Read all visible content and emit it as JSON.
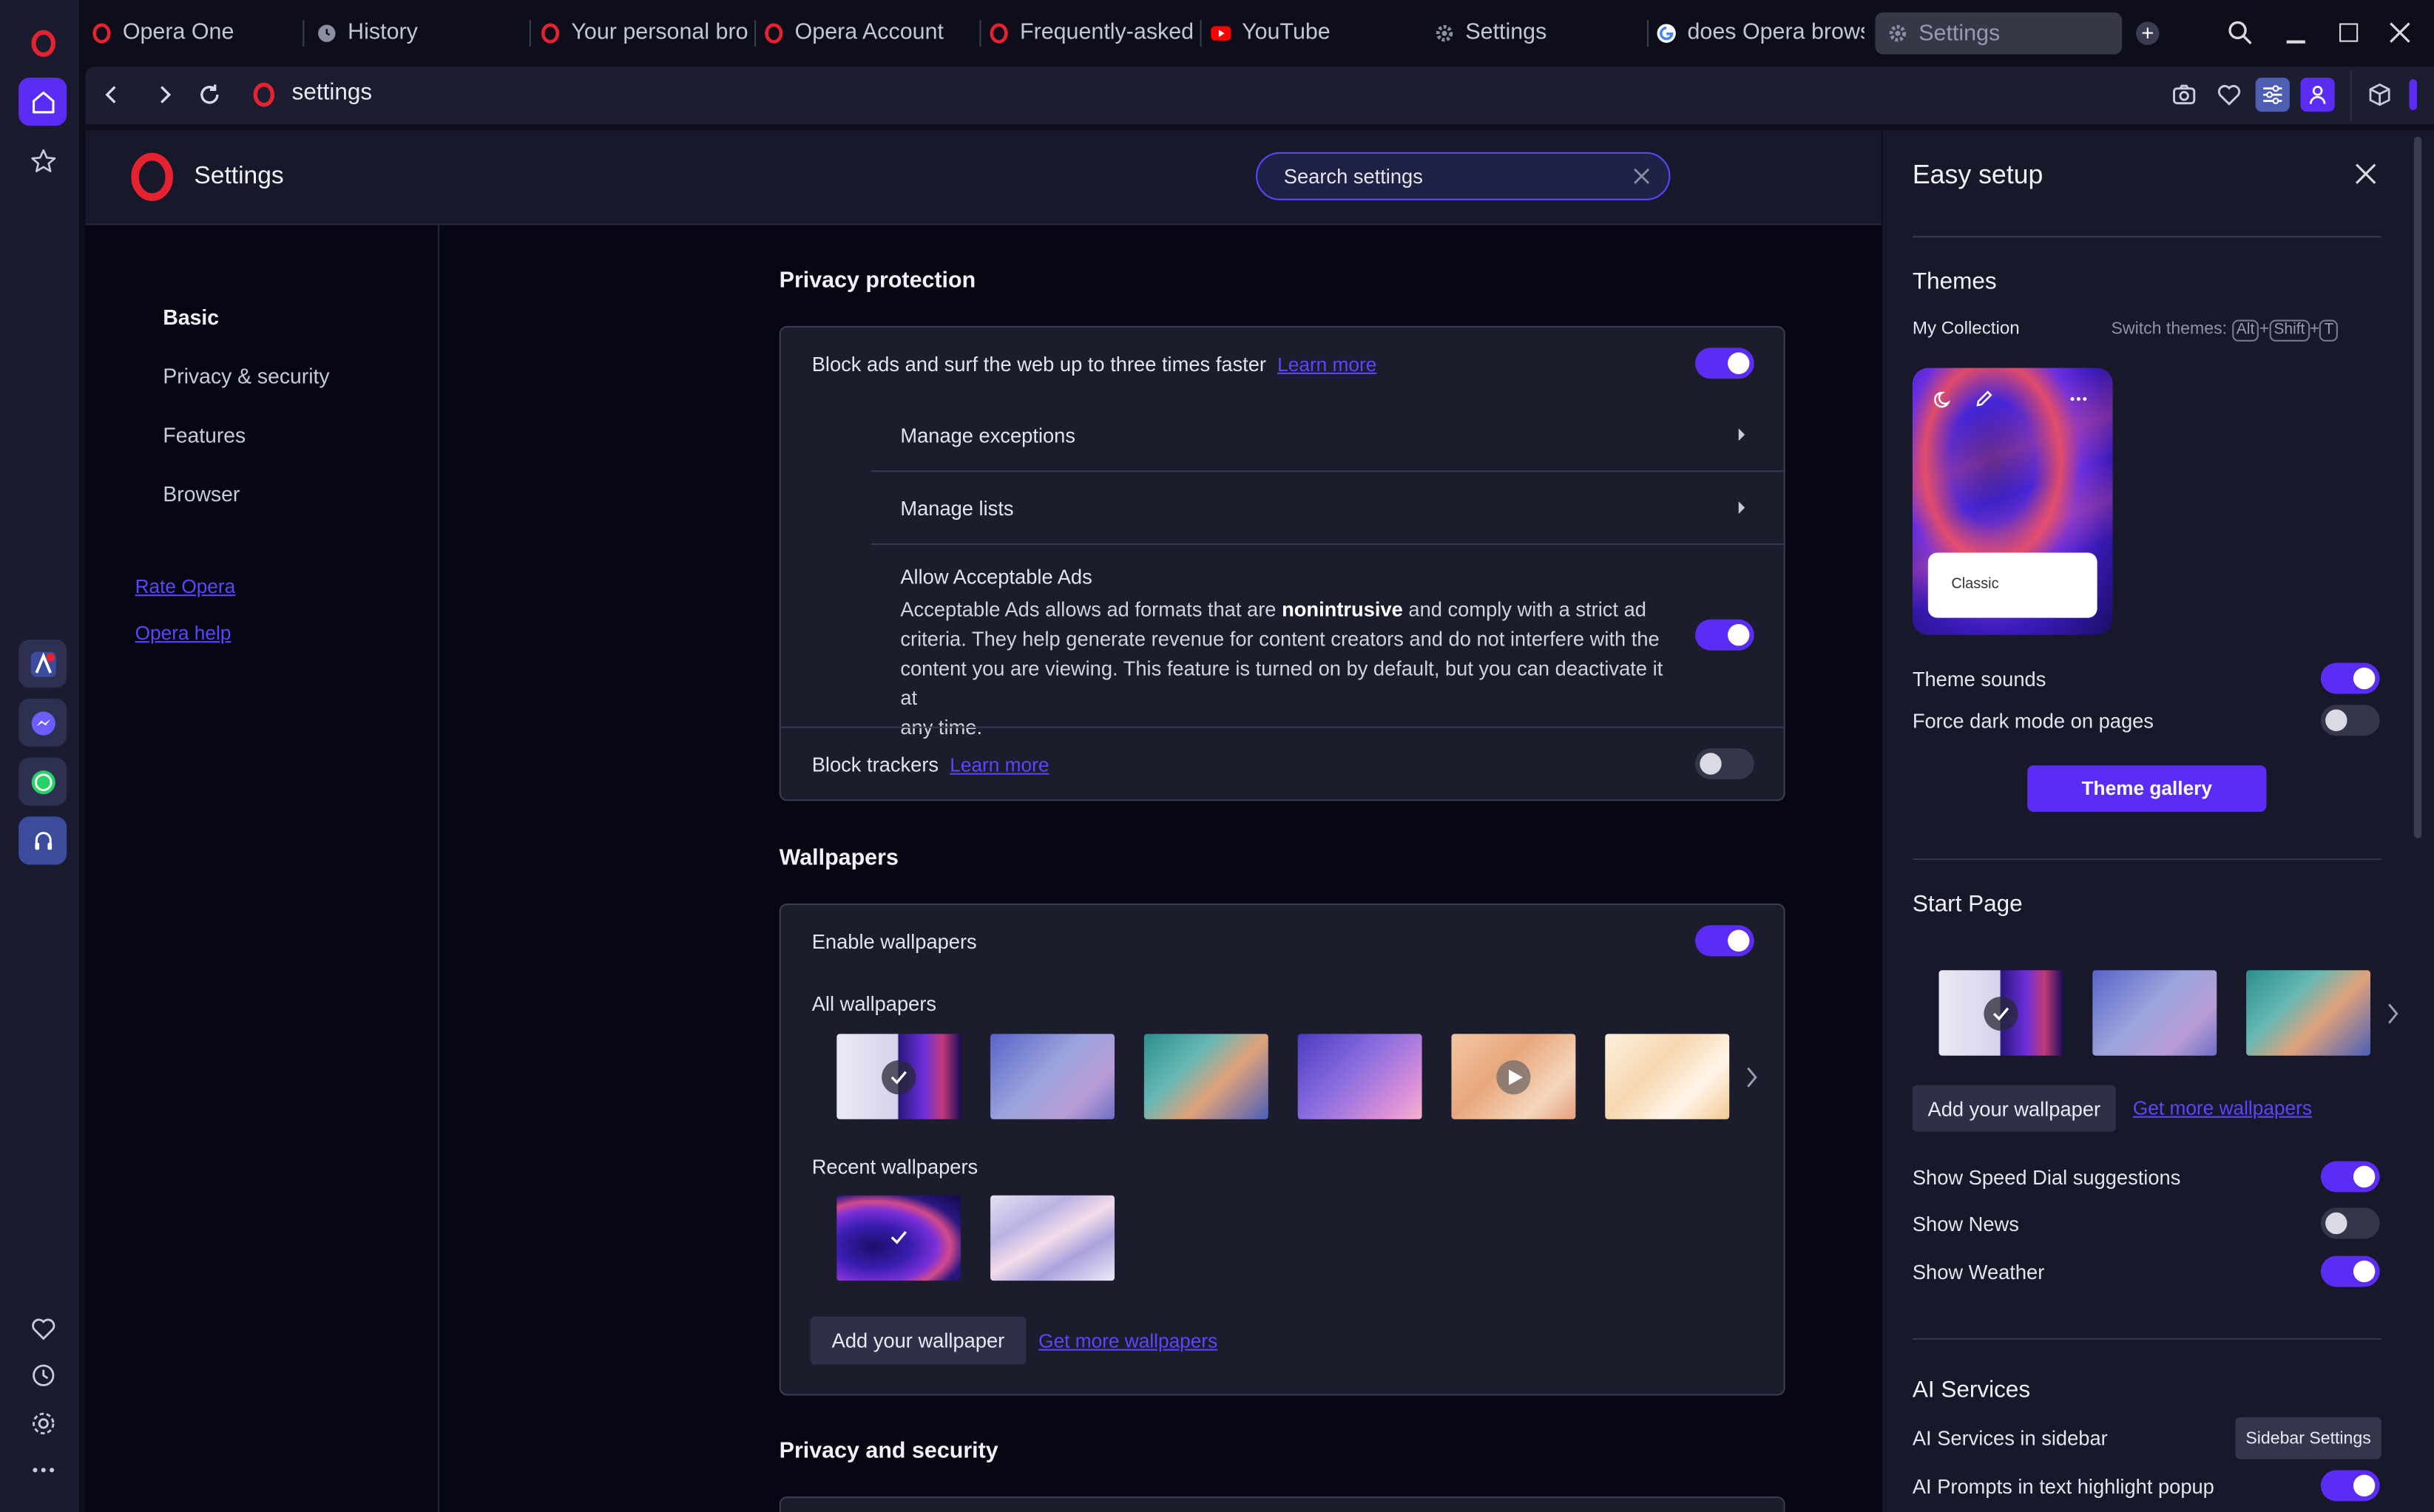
{
  "tabs": [
    {
      "label": "Opera One",
      "icon": "opera-icon"
    },
    {
      "label": "History",
      "icon": "history-icon"
    },
    {
      "label": "Your personal bro",
      "icon": "opera-icon"
    },
    {
      "label": "Opera Account",
      "icon": "opera-icon"
    },
    {
      "label": "Frequently-asked",
      "icon": "opera-icon"
    },
    {
      "label": "YouTube",
      "icon": "youtube-icon"
    },
    {
      "label": "Settings",
      "icon": "gear-icon"
    },
    {
      "label": "does Opera brows",
      "icon": "google-icon"
    },
    {
      "label": "Settings",
      "icon": "gear-icon"
    }
  ],
  "address": {
    "url": "settings"
  },
  "header": {
    "title": "Settings",
    "search_placeholder": "Search settings"
  },
  "nav": {
    "items": [
      "Basic",
      "Privacy & security",
      "Features",
      "Browser"
    ],
    "links": [
      "Rate Opera",
      "Opera help"
    ]
  },
  "privacy": {
    "title": "Privacy protection",
    "block_ads": "Block ads and surf the web up to three times faster",
    "learn_more": "Learn more",
    "manage_exceptions": "Manage exceptions",
    "manage_lists": "Manage lists",
    "acceptable_title": "Allow Acceptable Ads",
    "acceptable_desc_1": "Acceptable Ads allows ad formats that are",
    "acceptable_bold": "nonintrusive",
    "acceptable_desc_2": "and comply with a strict ad",
    "acceptable_line2": "criteria. They help generate revenue for content creators and do not interfere with the",
    "acceptable_line3": "content you are viewing. This feature is turned on by default, but you can deactivate it at",
    "acceptable_line4": "any time.",
    "block_trackers": "Block trackers",
    "block_ads_on": true,
    "acceptable_on": true,
    "trackers_on": false
  },
  "wallpapers": {
    "title": "Wallpapers",
    "enable": "Enable wallpapers",
    "enable_on": true,
    "all": "All wallpapers",
    "recent": "Recent wallpapers",
    "add": "Add your wallpaper",
    "get_more": "Get more wallpapers"
  },
  "privacy_security": {
    "title": "Privacy and security"
  },
  "easy_setup": {
    "title": "Easy setup",
    "themes": "Themes",
    "my_collection": "My Collection",
    "switch_themes": "Switch themes:",
    "kbd": [
      "Alt",
      "Shift",
      "T"
    ],
    "theme_card_label": "Classic",
    "theme_sounds": "Theme sounds",
    "force_dark": "Force dark mode on pages",
    "theme_gallery": "Theme gallery",
    "start_page": "Start Page",
    "add_wallpaper": "Add your wallpaper",
    "get_more_wallpapers": "Get more wallpapers",
    "speed_dial": "Show Speed Dial suggestions",
    "news": "Show News",
    "weather": "Show Weather",
    "ai_services": "AI Services",
    "ai_sidebar": "AI Services in sidebar",
    "sidebar_settings": "Sidebar Settings",
    "ai_prompts": "AI Prompts in text highlight popup",
    "theme_sounds_on": true,
    "force_dark_on": false,
    "speed_dial_on": true,
    "news_on": false,
    "weather_on": true,
    "ai_prompts_on": true
  },
  "colors": {
    "accent": "#5b2cf4",
    "link": "#5b46ff",
    "panel": "#17182a",
    "page_bg": "#060713"
  }
}
